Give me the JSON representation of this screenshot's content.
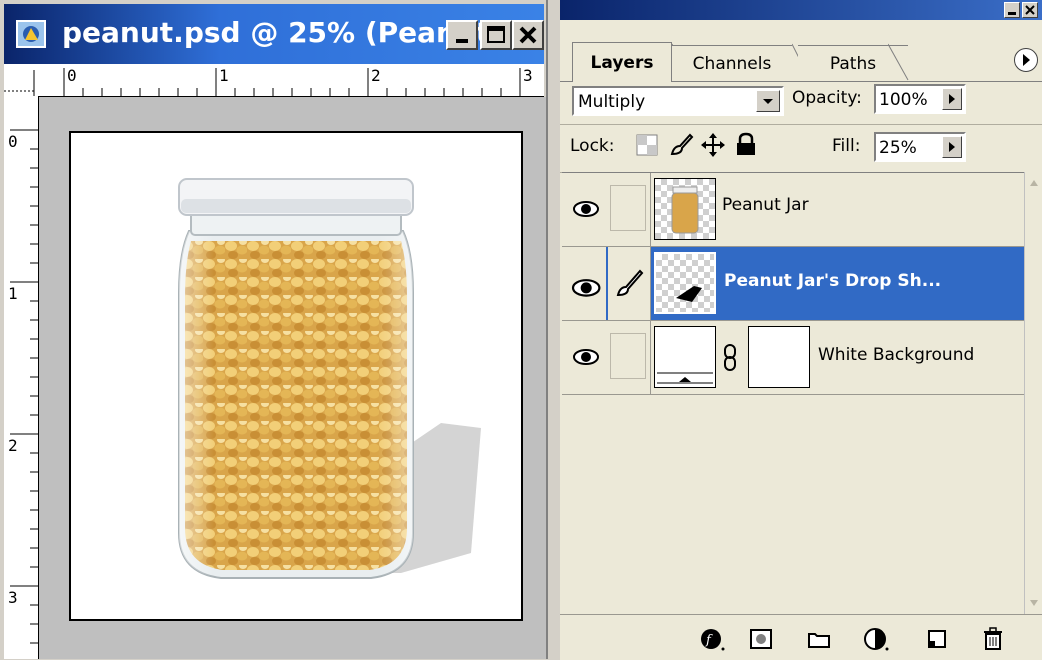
{
  "document": {
    "title": "peanut.psd @ 25% (Peanut ...",
    "ruler_h_labels": [
      "0",
      "1",
      "2",
      "3"
    ],
    "ruler_v_labels": [
      "0",
      "1",
      "2",
      "3"
    ]
  },
  "palette": {
    "tabs": [
      {
        "label": "Layers",
        "active": true
      },
      {
        "label": "Channels",
        "active": false
      },
      {
        "label": "Paths",
        "active": false
      }
    ],
    "blend_mode": "Multiply",
    "opacity_label": "Opacity:",
    "opacity_value": "100%",
    "lock_label": "Lock:",
    "fill_label": "Fill:",
    "fill_value": "25%",
    "layers": [
      {
        "name": "Peanut Jar",
        "selected": false,
        "visible": true
      },
      {
        "name": "Peanut Jar's Drop Sh...",
        "selected": true,
        "visible": true
      },
      {
        "name": "White Background",
        "selected": false,
        "visible": true
      }
    ]
  },
  "colors": {
    "title_bar": "#0a246a",
    "selection": "#316ac5",
    "panel_bg": "#ece9d8"
  },
  "icons": [
    "photoshop-doc-icon",
    "minimize-icon",
    "maximize-icon",
    "close-icon",
    "palette-menu-icon",
    "eye-icon",
    "brush-icon",
    "chain-link-icon",
    "layer-style-icon",
    "mask-icon",
    "folder-icon",
    "adjustment-icon",
    "new-layer-icon",
    "trash-icon"
  ]
}
